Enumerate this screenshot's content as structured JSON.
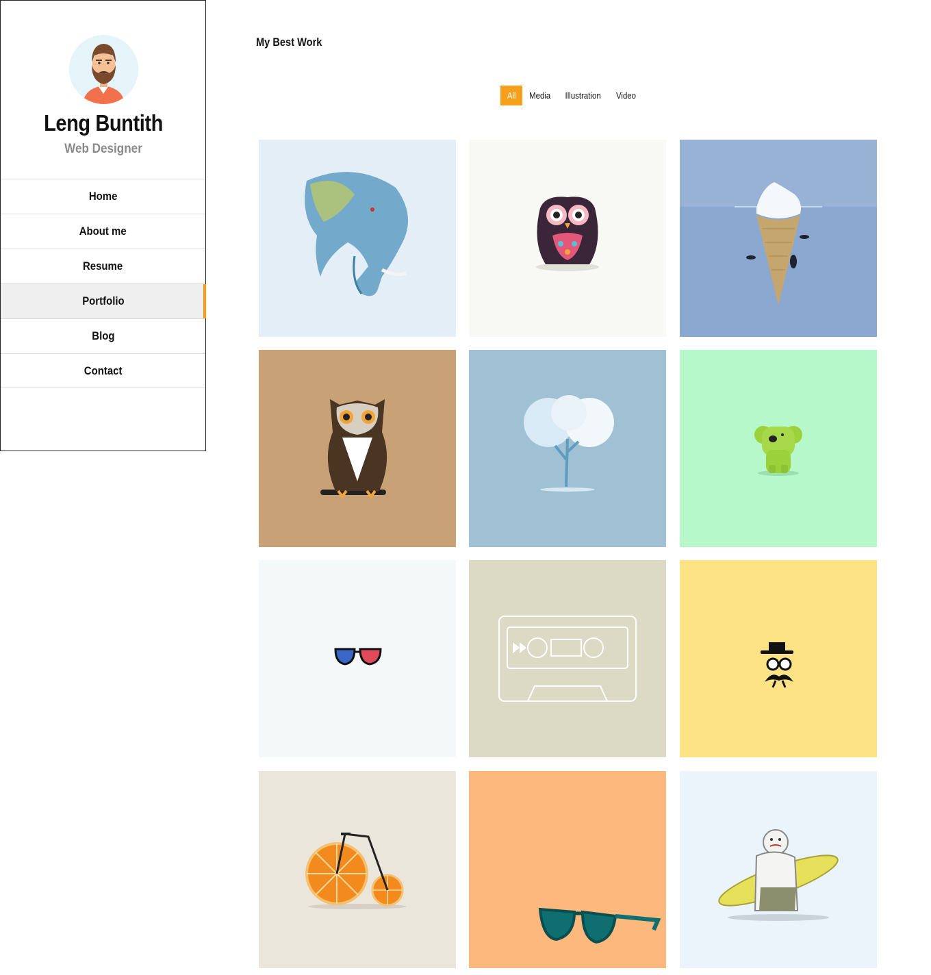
{
  "profile": {
    "name": "Leng Buntith",
    "role": "Web Designer"
  },
  "nav": {
    "items": [
      {
        "label": "Home",
        "active": false
      },
      {
        "label": "About me",
        "active": false
      },
      {
        "label": "Resume",
        "active": false
      },
      {
        "label": "Portfolio",
        "active": true
      },
      {
        "label": "Blog",
        "active": false
      },
      {
        "label": "Contact",
        "active": false
      }
    ]
  },
  "main": {
    "section_title": "My Best Work",
    "filters": [
      {
        "label": "All",
        "active": true
      },
      {
        "label": "Media",
        "active": false
      },
      {
        "label": "Illustration",
        "active": false
      },
      {
        "label": "Video",
        "active": false
      }
    ],
    "portfolio": [
      {
        "subject": "elephant-illustration",
        "background": "#e3eef6"
      },
      {
        "subject": "colorful-owl",
        "background": "#f8f9f4"
      },
      {
        "subject": "iceberg-ice-cream-cone",
        "background": "#98b2d6"
      },
      {
        "subject": "brown-owl-on-branch",
        "background": "#c8a276"
      },
      {
        "subject": "white-tree",
        "background": "#a0c0d4"
      },
      {
        "subject": "green-koala-toy",
        "background": "#b6f8c9"
      },
      {
        "subject": "3d-glasses",
        "background": "#f4f8f9"
      },
      {
        "subject": "cassette-tape",
        "background": "#dcd9c4"
      },
      {
        "subject": "mustache-gentleman",
        "background": "#fde385"
      },
      {
        "subject": "orange-slice-bicycle",
        "background": "#ebe6dc"
      },
      {
        "subject": "teal-sunglasses",
        "background": "#fdb87d"
      },
      {
        "subject": "surfer-character",
        "background": "#ebf4fa"
      }
    ]
  },
  "colors": {
    "accent": "#f5a01a",
    "active_nav_bg": "#efefef",
    "role_text": "#8a8a8a"
  }
}
